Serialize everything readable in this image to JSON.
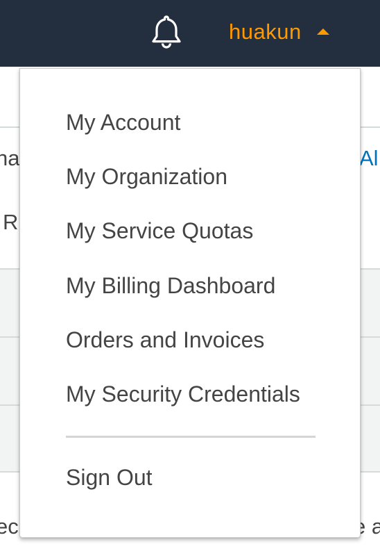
{
  "header": {
    "notifications_icon": "bell-icon",
    "username": "huakun",
    "username_caret_icon": "caret-up-icon",
    "brand_color": "#ff9900",
    "bar_color": "#232f3e"
  },
  "background": {
    "fragment_1": "na",
    "fragment_2": "Al",
    "fragment_3": "R",
    "fragment_4": "ec",
    "fragment_5": "e a"
  },
  "account_menu": {
    "items": [
      {
        "label": "My Account"
      },
      {
        "label": "My Organization"
      },
      {
        "label": "My Service Quotas"
      },
      {
        "label": "My Billing Dashboard"
      },
      {
        "label": "Orders and Invoices"
      },
      {
        "label": "My Security Credentials"
      }
    ],
    "sign_out_label": "Sign Out"
  }
}
